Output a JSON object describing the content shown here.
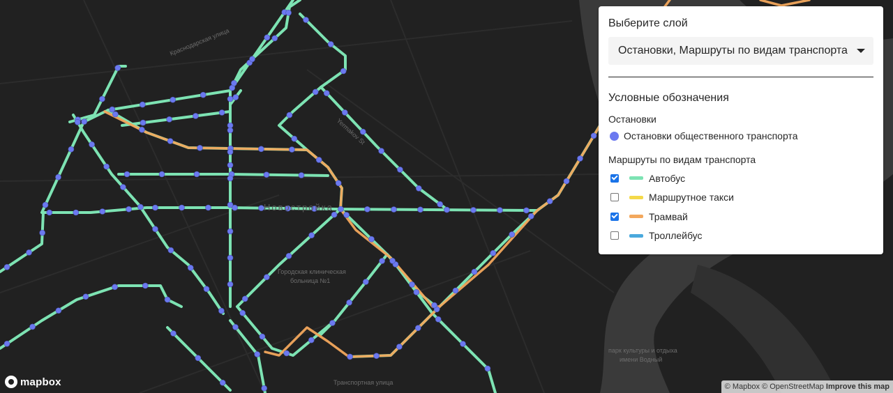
{
  "map": {
    "labels": {
      "street_1": "Краснодарская улица",
      "street_2": "Yermakov St",
      "district": "Новостройка",
      "hospital_line1": "Городская клиническая",
      "hospital_line2": "больница №1",
      "park_line1": "парк культуры и отдыха",
      "park_line2": "имени Водный",
      "street_3": "Транспортная улица"
    },
    "colors": {
      "background": "#212121",
      "water": "#3a3a3a",
      "land_major": "#2b2b2b",
      "bus": "#7de3b3",
      "minibus": "#f4d94a",
      "tram": "#f3a85d",
      "trolleybus": "#4aa9dd",
      "stop": "#6b79f0"
    }
  },
  "panel": {
    "layer_title": "Выберите слой",
    "layer_selected": "Остановки, Маршруты по видам транспорта",
    "legend_title": "Условные обозначения",
    "stops_group": "Остановки",
    "stops_item": "Остановки общественного транспорта",
    "routes_group": "Маршруты по видам транспорта",
    "routes": [
      {
        "label": "Автобус",
        "checked": true,
        "color": "#7de3b3"
      },
      {
        "label": "Маршрутное такси",
        "checked": false,
        "color": "#f4d94a"
      },
      {
        "label": "Трамвай",
        "checked": true,
        "color": "#f3a85d"
      },
      {
        "label": "Троллейбус",
        "checked": false,
        "color": "#4aa9dd"
      }
    ]
  },
  "footer": {
    "logo_text": "mapbox",
    "attribution_mapbox": "© Mapbox",
    "attribution_osm": "© OpenStreetMap",
    "improve": "Improve this map"
  }
}
